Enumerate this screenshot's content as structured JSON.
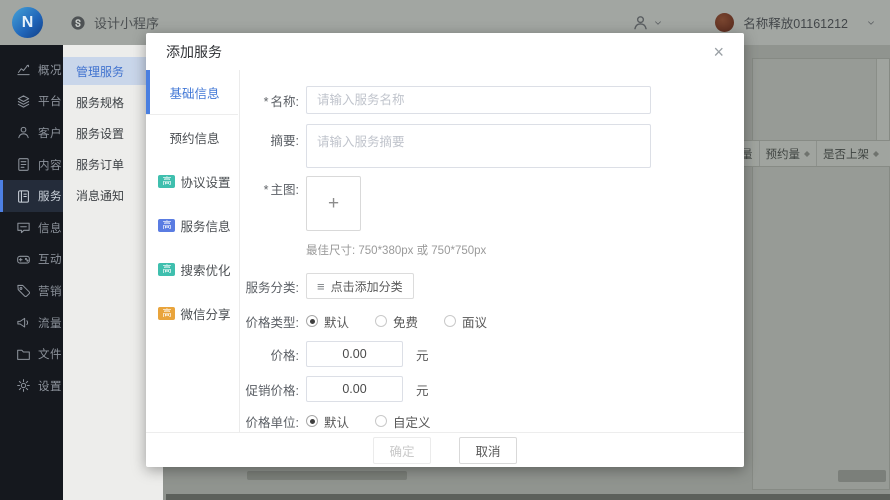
{
  "topbar": {
    "logo_letter": "N",
    "app_name": "设计小程序",
    "user_name": "名称释放01161212"
  },
  "sidebar": {
    "items": [
      {
        "label": "概况",
        "icon": "chart-icon"
      },
      {
        "label": "平台",
        "icon": "layers-icon"
      },
      {
        "label": "客户",
        "icon": "user-icon"
      },
      {
        "label": "内容",
        "icon": "document-icon"
      },
      {
        "label": "服务",
        "icon": "service-book-icon",
        "active": true
      },
      {
        "label": "信息",
        "icon": "chat-icon"
      },
      {
        "label": "互动",
        "icon": "gamepad-icon"
      },
      {
        "label": "营销",
        "icon": "tag-icon"
      },
      {
        "label": "流量",
        "icon": "megaphone-icon"
      },
      {
        "label": "文件",
        "icon": "folder-icon"
      },
      {
        "label": "设置",
        "icon": "gear-icon"
      }
    ]
  },
  "subsidebar": {
    "items": [
      {
        "label": "管理服务",
        "active": true
      },
      {
        "label": "服务规格"
      },
      {
        "label": "服务设置"
      },
      {
        "label": "服务订单"
      },
      {
        "label": "消息通知"
      }
    ]
  },
  "background": {
    "table_columns": [
      {
        "label": "量"
      },
      {
        "label": "预约量",
        "sortable": true
      },
      {
        "label": "是否上架",
        "sortable": true
      }
    ]
  },
  "modal": {
    "title": "添加服务",
    "close_glyph": "×",
    "tabs": [
      {
        "label": "基础信息",
        "active": true
      },
      {
        "label": "预约信息"
      },
      {
        "label": "协议设置",
        "badge": "高",
        "badge_color": "#3fbfae"
      },
      {
        "label": "服务信息",
        "badge": "高",
        "badge_color": "#5a7ce2"
      },
      {
        "label": "搜索优化",
        "badge": "高",
        "badge_color": "#3fbfae"
      },
      {
        "label": "微信分享",
        "badge": "高",
        "badge_color": "#e9a43c"
      }
    ],
    "form": {
      "required_mark": "*",
      "name": {
        "label": "名称:",
        "placeholder": "请输入服务名称"
      },
      "summary": {
        "label": "摘要:",
        "placeholder": "请输入服务摘要"
      },
      "main_image": {
        "label": "主图:",
        "plus_glyph": "+",
        "hint": "最佳尺寸: 750*380px 或 750*750px"
      },
      "category": {
        "label": "服务分类:",
        "button_icon_glyph": "≡",
        "button_label": "点击添加分类"
      },
      "price_type": {
        "label": "价格类型:",
        "options": [
          {
            "label": "默认",
            "selected": true
          },
          {
            "label": "免费",
            "selected": false
          },
          {
            "label": "面议",
            "selected": false
          }
        ]
      },
      "price": {
        "label": "价格:",
        "value": "0.00",
        "unit": "元"
      },
      "promo_price": {
        "label": "促销价格:",
        "value": "0.00",
        "unit": "元"
      },
      "price_unit": {
        "label": "价格单位:",
        "options": [
          {
            "label": "默认",
            "selected": true
          },
          {
            "label": "自定义",
            "selected": false
          }
        ]
      }
    },
    "footer": {
      "confirm_label": "确定",
      "cancel_label": "取消"
    }
  }
}
